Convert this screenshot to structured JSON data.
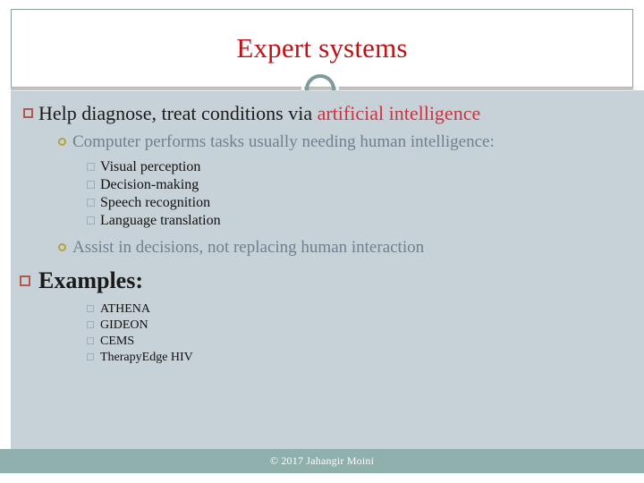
{
  "slide": {
    "title": "Expert systems",
    "title_color": "#bb1417",
    "body_background": "#c7d2d8",
    "footer_background": "#8fb0ac",
    "accent_red": "#cc3340"
  },
  "content": {
    "bullet1": {
      "text_plain": "Help diagnose, treat conditions via ",
      "text_accent": "artificial intelligence"
    },
    "bullet2a": "Computer performs tasks usually needing human intelligence:",
    "sublist": [
      "Visual perception",
      "Decision-making",
      "Speech recognition",
      "Language translation"
    ],
    "bullet2b": "Assist in decisions, not replacing human interaction",
    "examples_heading": "Examples:",
    "examples": [
      "ATHENA",
      "GIDEON",
      "CEMS",
      "TherapyEdge HIV"
    ]
  },
  "footer": {
    "copyright": "© 2017 Jahangir Moini"
  }
}
